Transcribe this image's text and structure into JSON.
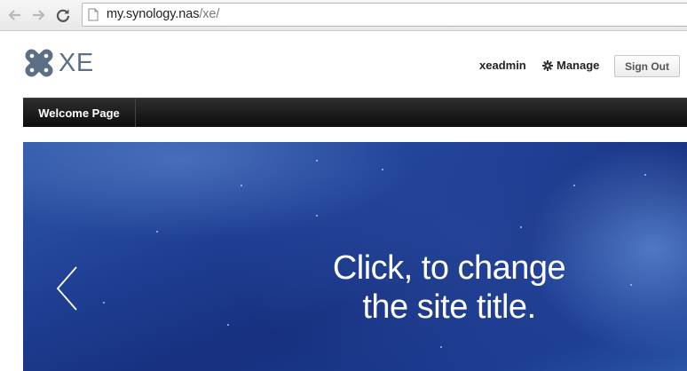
{
  "browser": {
    "url_host": "my.synology.nas",
    "url_path": "/xe/"
  },
  "header": {
    "logo_text": "XE",
    "user_name": "xeadmin",
    "manage_label": "Manage",
    "sign_out_label": "Sign Out"
  },
  "nav": {
    "items": [
      {
        "label": "Welcome Page"
      }
    ]
  },
  "hero": {
    "title_line1": "Click, to change",
    "title_line2": "the site title."
  },
  "colors": {
    "logo": "#5c6f86",
    "nav_bar": "#111111",
    "hero_blue": "#1f3f93"
  },
  "icons": [
    "back-arrow-icon",
    "forward-arrow-icon",
    "reload-icon",
    "page-icon",
    "xe-logo-icon",
    "gear-icon",
    "chevron-left-icon"
  ]
}
